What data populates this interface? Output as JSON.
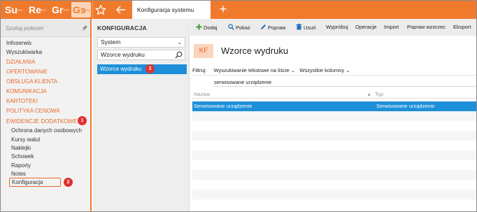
{
  "topbar": {
    "apps": [
      {
        "label": "Su",
        "badge": "PRO"
      },
      {
        "label": "Re",
        "badge": "PRO"
      },
      {
        "label": "Gr",
        "badge": "PRO"
      },
      {
        "label": "Gs",
        "badge": "PRO"
      }
    ],
    "active_tab": "Konfiguracja systemu",
    "add_tab": "+",
    "accent_color": "#f07a2c"
  },
  "sidebar": {
    "search_placeholder": "Szukaj poleceń",
    "items": [
      {
        "label": "Infoserwis",
        "style": "plain"
      },
      {
        "label": "Wyszukiwarka",
        "style": "plain"
      },
      {
        "label": "DZIAŁANIA",
        "style": "orange"
      },
      {
        "label": "OFERTOWANIE",
        "style": "orange"
      },
      {
        "label": "OBSŁUGA KLIENTA",
        "style": "orange"
      },
      {
        "label": "KOMUNIKACJA",
        "style": "orange"
      },
      {
        "label": "KARTOTEKI",
        "style": "orange"
      },
      {
        "label": "POLITYKA CENOWA",
        "style": "orange"
      },
      {
        "label": "EWIDENCJE DODATKOWE",
        "style": "orange"
      }
    ],
    "subitems": [
      {
        "label": "Ochrona danych osobowych"
      },
      {
        "label": "Kursy walut"
      },
      {
        "label": "Naklejki"
      },
      {
        "label": "Schowek"
      },
      {
        "label": "Raporty"
      },
      {
        "label": "Notes"
      },
      {
        "label": "Konfiguracja"
      }
    ]
  },
  "badges": {
    "b1": "1",
    "b2": "2",
    "b3": "3"
  },
  "config_panel": {
    "title": "KONFIGURACJA",
    "system_select": "System",
    "search_value": "Wzorce wydruku",
    "selected_item": "Wzorce wydruku"
  },
  "toolbar": {
    "dodaj": "Dodaj",
    "pokaz": "Pokaż",
    "popraw": "Popraw",
    "usun": "Usuń",
    "wyprobuj": "Wypróbuj",
    "operacje": "Operacje",
    "import": "Import",
    "popraw_wzorzec": "Popraw wzorzec",
    "eksport": "Eksport"
  },
  "main": {
    "tile": "KF",
    "title": "Wzorce wydruku",
    "filter_label": "Filtruj:",
    "filter_mode": "Wyszukiwanie tekstowe na liście",
    "filter_columns": "Wszystkie kolumny",
    "filter_value": "serwisowane urządzenie",
    "columns": {
      "name": "Nazwa",
      "type": "Typ"
    },
    "rows": [
      {
        "name": "Serwisowane urządzenie",
        "type": "Serwisowane urządzenie"
      }
    ]
  }
}
